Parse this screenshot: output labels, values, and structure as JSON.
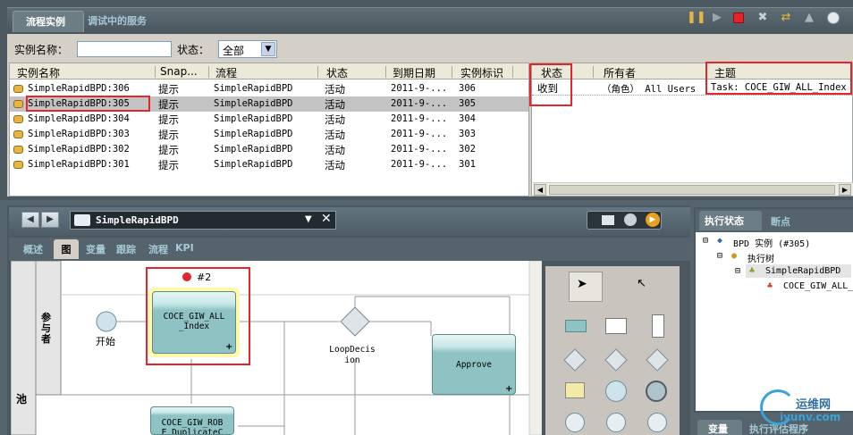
{
  "top_tabs": {
    "active": "流程实例",
    "inactive": "调试中的服务"
  },
  "toolbar": {
    "icons": [
      "pause-icon",
      "play-icon",
      "stop-icon",
      "close-icon",
      "refresh-icon",
      "up-icon",
      "info-icon"
    ],
    "colors": {
      "stop": "#e3262b",
      "pause": "#e8b540"
    }
  },
  "filter": {
    "name_label": "实例名称：",
    "name_value": "",
    "status_label": "状态：",
    "status_value": "全部"
  },
  "instances_table": {
    "columns": [
      "实例名称",
      "Snap...",
      "流程",
      "状态",
      "到期日期",
      "实例标识"
    ],
    "rows": [
      {
        "name": "SimpleRapidBPD:306",
        "snap": "提示",
        "process": "SimpleRapidBPD",
        "status": "活动",
        "due": "2011-9-...",
        "id": "306"
      },
      {
        "name": "SimpleRapidBPD:305",
        "snap": "提示",
        "process": "SimpleRapidBPD",
        "status": "活动",
        "due": "2011-9-...",
        "id": "305"
      },
      {
        "name": "SimpleRapidBPD:304",
        "snap": "提示",
        "process": "SimpleRapidBPD",
        "status": "活动",
        "due": "2011-9-...",
        "id": "304"
      },
      {
        "name": "SimpleRapidBPD:303",
        "snap": "提示",
        "process": "SimpleRapidBPD",
        "status": "活动",
        "due": "2011-9-...",
        "id": "303"
      },
      {
        "name": "SimpleRapidBPD:302",
        "snap": "提示",
        "process": "SimpleRapidBPD",
        "status": "活动",
        "due": "2011-9-...",
        "id": "302"
      },
      {
        "name": "SimpleRapidBPD:301",
        "snap": "提示",
        "process": "SimpleRapidBPD",
        "status": "活动",
        "due": "2011-9-...",
        "id": "301"
      }
    ],
    "selected": "SimpleRapidBPD:305"
  },
  "tasks_table": {
    "columns": [
      "状态",
      "所有者",
      "主题"
    ],
    "rows": [
      {
        "status": "收到",
        "owner": "（角色） All Users",
        "subject": "Task: COCE_GIW_ALL_Index"
      }
    ]
  },
  "diagram": {
    "title": "SimpleRapidBPD",
    "subtabs": [
      "概述",
      "图",
      "变量",
      "跟踪",
      "流程",
      "KPI"
    ],
    "active_subtab": "图",
    "lane_label": "参与者",
    "pool_label": "池",
    "start_label": "开始",
    "token_label": "#2",
    "activity_1": "COCE_GIW_ALL\n_Index",
    "activity_2": "Approve",
    "activity_3": "COCE_GIW_ROB\nE_DuplicateC",
    "decision_label": "LoopDecis\nion"
  },
  "exec_state": {
    "tabs": [
      "执行状态",
      "断点"
    ],
    "tree": [
      "BPD 实例 (#305)",
      "执行树",
      "SimpleRapidBPD",
      "COCE_GIW_ALL_"
    ]
  },
  "bottom_tabs": [
    "变量",
    "执行评估程序"
  ],
  "watermark": {
    "site": "运维网",
    "url": "iyunv.com"
  }
}
